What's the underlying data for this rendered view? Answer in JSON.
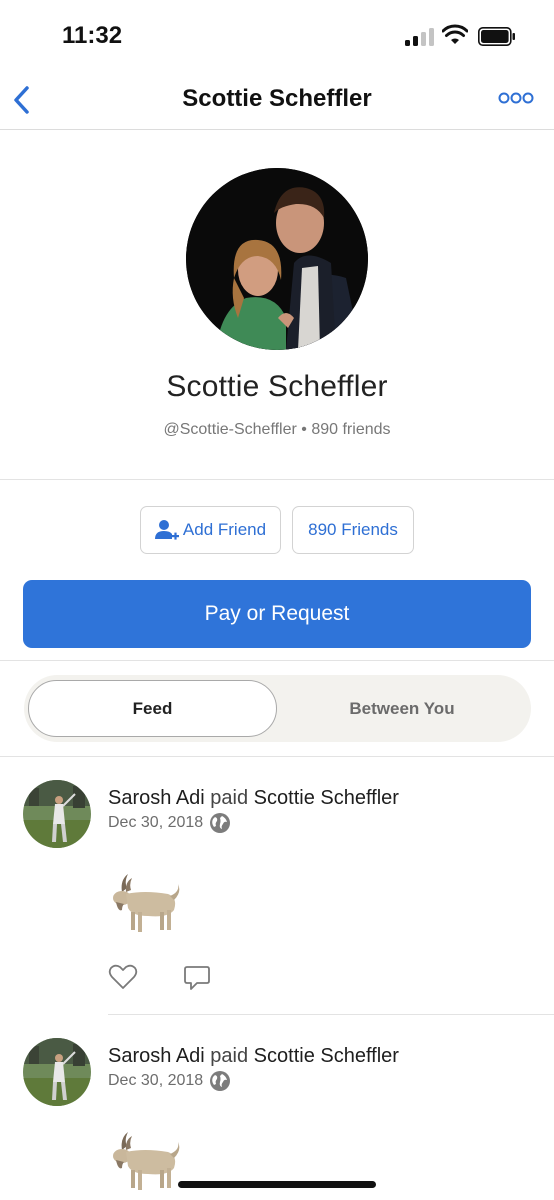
{
  "status_bar": {
    "time": "11:32"
  },
  "nav": {
    "title": "Scottie Scheffler",
    "back_icon": "chevron-left-icon",
    "more_icon": "more-dots-icon"
  },
  "profile": {
    "name": "Scottie Scheffler",
    "username": "@Scottie-Scheffler",
    "separator": "•",
    "friends_count_text": "890 friends"
  },
  "actions": {
    "add_friend_label": "Add Friend",
    "friends_label": "890 Friends",
    "pay_request_label": "Pay or Request"
  },
  "tabs": [
    {
      "label": "Feed",
      "active": true
    },
    {
      "label": "Between You",
      "active": false
    }
  ],
  "feed": [
    {
      "actor": "Sarosh Adi",
      "verb": "paid",
      "target": "Scottie Scheffler",
      "date": "Dec 30, 2018",
      "note_emoji": "goat"
    },
    {
      "actor": "Sarosh Adi",
      "verb": "paid",
      "target": "Scottie Scheffler",
      "date": "Dec 30, 2018",
      "note_emoji": "goat"
    }
  ],
  "colors": {
    "accent": "#2f74d9",
    "link": "#2e6fd4",
    "segment_bg": "#f3f2ee"
  }
}
